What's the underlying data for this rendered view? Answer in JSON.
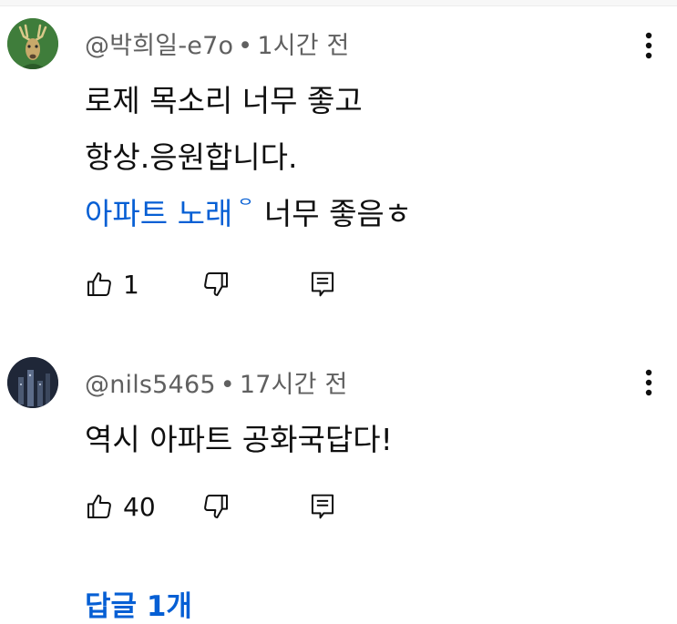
{
  "comments": [
    {
      "author": "@박희일-e7o",
      "separator": "•",
      "time": "1시간 전",
      "lines": [
        "로제 목소리 너무 좋고",
        "항상.응원합니다."
      ],
      "last_line_link": "아파트 노래",
      "last_line_sup": "ᄋ",
      "last_line_rest": "너무 좋음ㅎ",
      "likes": "1",
      "avatar_icon": "deer-avatar-icon"
    },
    {
      "author": "@nils5465",
      "separator": "•",
      "time": "17시간 전",
      "lines": [
        "역시 아파트 공화국답다!"
      ],
      "likes": "40",
      "avatar_icon": "night-avatar-icon"
    }
  ],
  "replies_label": "답글 1개",
  "colors": {
    "link": "#065fd4",
    "meta": "#606060",
    "text": "#0f0f0f"
  },
  "icons": [
    "more-vert-icon",
    "thumbs-up-icon",
    "thumbs-down-icon",
    "reply-icon"
  ]
}
